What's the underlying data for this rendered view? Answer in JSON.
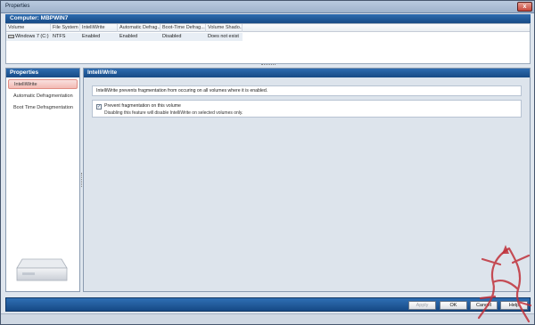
{
  "window": {
    "title": "Properties",
    "close_label": "x"
  },
  "computer": {
    "header": "Computer: MBPWIN7"
  },
  "volumes": {
    "columns": [
      "Volume",
      "File System",
      "IntelliWrite",
      "Automatic Defrag...",
      "Boot-Time Defrag...",
      "Volume Shado..."
    ],
    "rows": [
      [
        "Windows 7 (C:)",
        "NTFS",
        "Enabled",
        "Enabled",
        "Disabled",
        "Does not exist"
      ]
    ]
  },
  "nav": {
    "header": "Properties",
    "items": [
      {
        "label": "IntelliWrite",
        "selected": true
      },
      {
        "label": "Automatic Defragmentation",
        "selected": false
      },
      {
        "label": "Boot Time Defragmentation",
        "selected": false
      }
    ]
  },
  "main": {
    "header": "IntelliWrite",
    "intro": "IntelliWrite prevents fragmentation from occuring on all volumes where it is enabled.",
    "option": {
      "label": "Prevent fragmentation on this volume",
      "checked": true,
      "description": "Disabling this feature will disable IntelliWrite on selected volumes only."
    }
  },
  "buttons": {
    "apply": "Apply",
    "ok": "OK",
    "cancel": "Cancel",
    "help": "Help"
  },
  "colors": {
    "header_blue": "#1f5a9b",
    "selected_nav": "#f2b9b3",
    "watermark_red": "#c0303a"
  }
}
